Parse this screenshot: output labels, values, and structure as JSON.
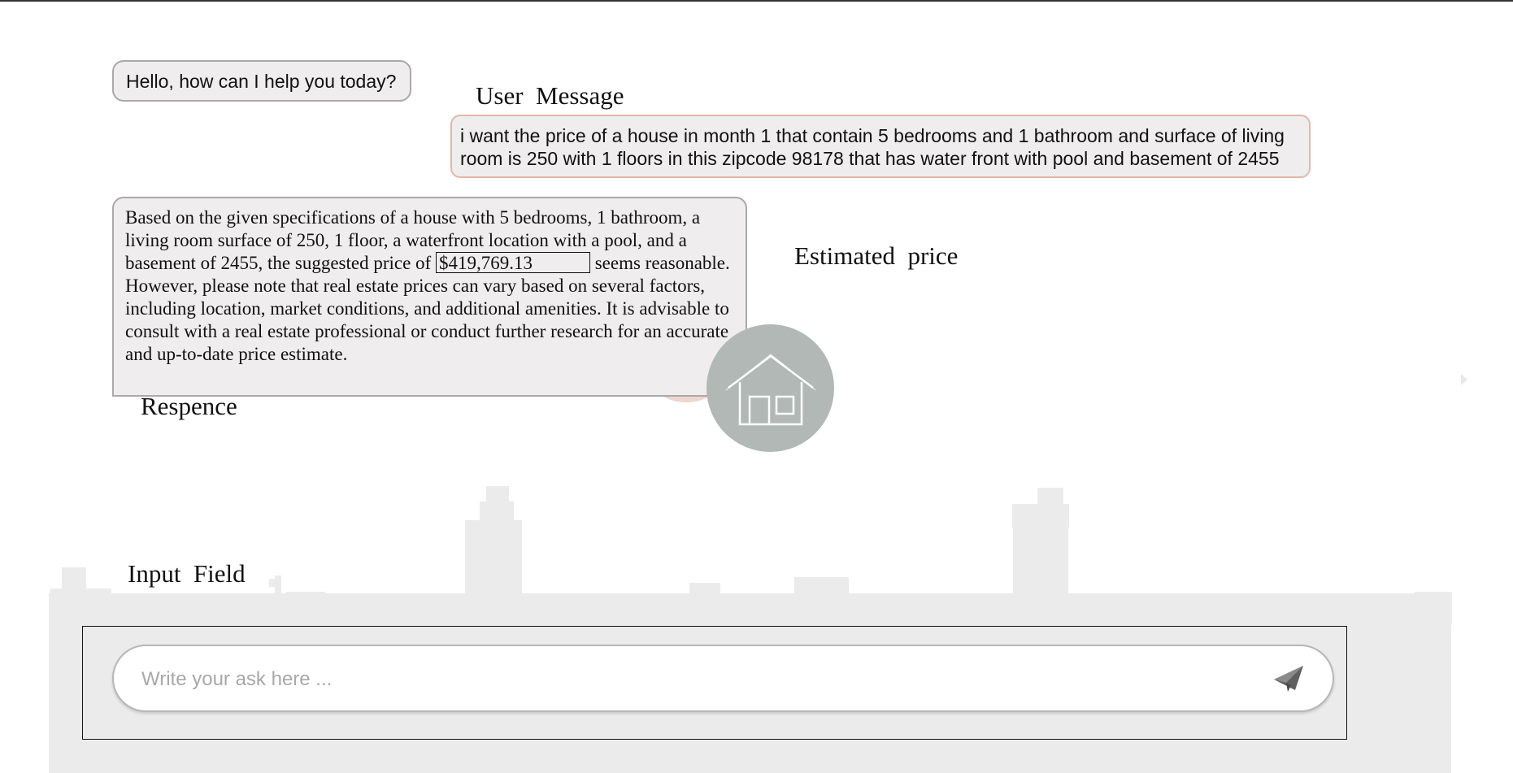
{
  "chat": {
    "greeting": "Hello, how can I help you today?",
    "user_message": "i want the price of a house in month 1 that contain 5 bedrooms and 1 bathroom and surface of living room is 250 with 1 floors in this zipcode 98178 that has water front with pool and basement of 2455",
    "response_before": "Based on the given specifications of a house with 5 bedrooms, 1 bathroom, a living room surface of 250, 1 floor, a waterfront location with a pool, and a basement of 2455, the suggested price of ",
    "response_price": "$419,769.13",
    "response_after": " seems reasonable. However, please note that real estate prices can vary based on several factors, including location, market conditions, and additional amenities. It is advisable to consult with a real estate professional or conduct further research for an accurate and up-to-date price estimate."
  },
  "annotations": {
    "user_message": "User  Message",
    "estimated_price": "Estimated  price",
    "response": "Respence",
    "input_field": "Input  Field"
  },
  "input": {
    "placeholder": "Write your ask here ...",
    "value": ""
  },
  "icons": {
    "dollar": "dollar-icon",
    "house": "house-icon",
    "send": "paper-plane-send-icon",
    "arrow": "chevron-right-icon"
  },
  "colors": {
    "bubble_bg": "#efedee",
    "user_border": "#e3b8a6",
    "bot_border": "#a9a9a9",
    "house_circle": "#b1b8b5",
    "dollar_circle": "#e6c8be",
    "skyline": "#ebebeb"
  }
}
